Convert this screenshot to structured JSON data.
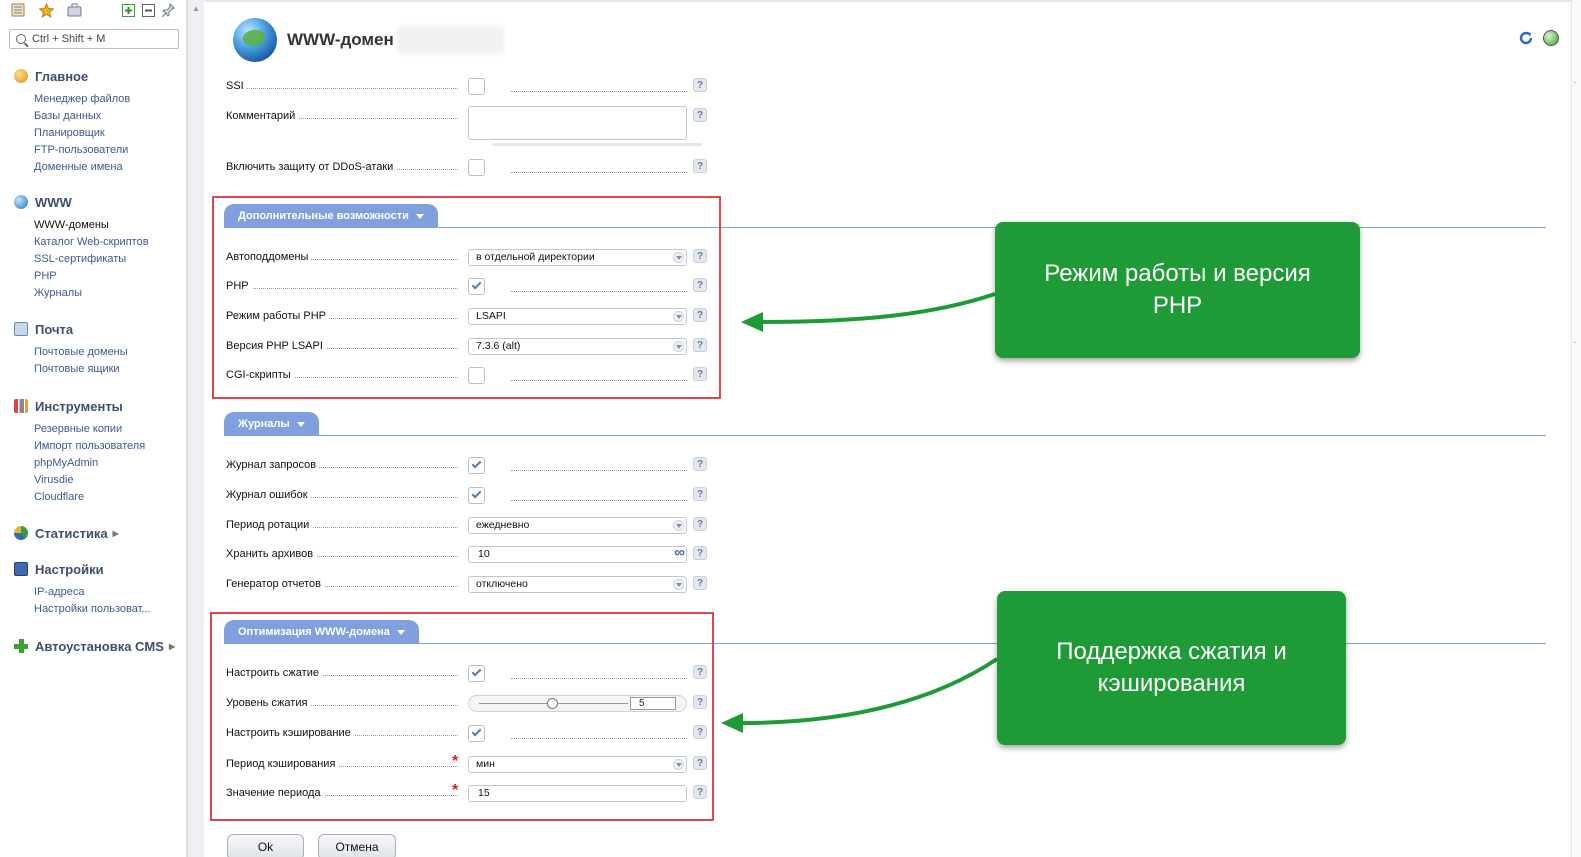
{
  "toolbar": {
    "icons": [
      "tree-icon",
      "star-icon",
      "briefcase-icon",
      "add-icon",
      "collapse-icon",
      "pin-icon"
    ]
  },
  "search": {
    "placeholder": "Ctrl + Shift + M"
  },
  "sidebar": {
    "sections": [
      {
        "title": "Главное",
        "items": [
          "Менеджер файлов",
          "Базы данных",
          "Планировщик",
          "FTP-пользователи",
          "Доменные имена"
        ]
      },
      {
        "title": "WWW",
        "items": [
          "WWW-домены",
          "Каталог Web-скриптов",
          "SSL-сертификаты",
          "PHP",
          "Журналы"
        ]
      },
      {
        "title": "Почта",
        "items": [
          "Почтовые домены",
          "Почтовые ящики"
        ]
      },
      {
        "title": "Инструменты",
        "items": [
          "Резервные копии",
          "Импорт пользователя",
          "phpMyAdmin",
          "Virusdie",
          "Cloudflare"
        ]
      },
      {
        "title": "Статистика",
        "items": []
      },
      {
        "title": "Настройки",
        "items": [
          "IP-адреса",
          "Настройки пользоват..."
        ]
      },
      {
        "title": "Автоустановка CMS",
        "items": []
      }
    ]
  },
  "header": {
    "title": "WWW-домен"
  },
  "form": {
    "top": [
      {
        "label": "SSI",
        "type": "checkbox",
        "checked": false
      },
      {
        "label": "Комментарий",
        "type": "textarea",
        "value": ""
      },
      {
        "label": "Включить защиту от DDoS-атаки",
        "type": "checkbox",
        "checked": false
      }
    ],
    "tabs": {
      "extra": "Дополнительные возможности",
      "logs": "Журналы",
      "optim": "Оптимизация WWW-домена"
    },
    "extra": [
      {
        "label": "Автоподдомены",
        "type": "select",
        "value": "в отдельной директории"
      },
      {
        "label": "PHP",
        "type": "checkbox",
        "checked": true
      },
      {
        "label": "Режим работы PHP",
        "type": "select",
        "value": "LSAPI"
      },
      {
        "label": "Версия PHP LSAPI",
        "type": "select",
        "value": "7.3.6 (alt)"
      },
      {
        "label": "CGI-скрипты",
        "type": "checkbox",
        "checked": false
      }
    ],
    "logs": [
      {
        "label": "Журнал запросов",
        "type": "checkbox",
        "checked": true
      },
      {
        "label": "Журнал ошибок",
        "type": "checkbox",
        "checked": true
      },
      {
        "label": "Период ротации",
        "type": "select",
        "value": "ежедневно"
      },
      {
        "label": "Хранить архивов",
        "type": "text",
        "value": "10"
      },
      {
        "label": "Генератор отчетов",
        "type": "select",
        "value": "отключено"
      }
    ],
    "optim": [
      {
        "label": "Настроить сжатие",
        "type": "checkbox",
        "checked": true
      },
      {
        "label": "Уровень сжатия",
        "type": "slider",
        "value": "5"
      },
      {
        "label": "Настроить кэширование",
        "type": "checkbox",
        "checked": true
      },
      {
        "label": "Период кэширования",
        "type": "select",
        "value": "мин",
        "required": true
      },
      {
        "label": "Значение периода",
        "type": "text",
        "value": "15",
        "required": true
      }
    ],
    "help": "?",
    "infinity": "∞",
    "required_mark": "*"
  },
  "callouts": {
    "php": "Режим работы и версия PHP",
    "compress": "Поддержка сжатия и кэширования"
  },
  "buttons": {
    "ok": "Ok",
    "cancel": "Отмена"
  },
  "colors": {
    "accent": "#7fa0dc",
    "callout": "#1e9b36",
    "highlight": "#e0474c"
  }
}
